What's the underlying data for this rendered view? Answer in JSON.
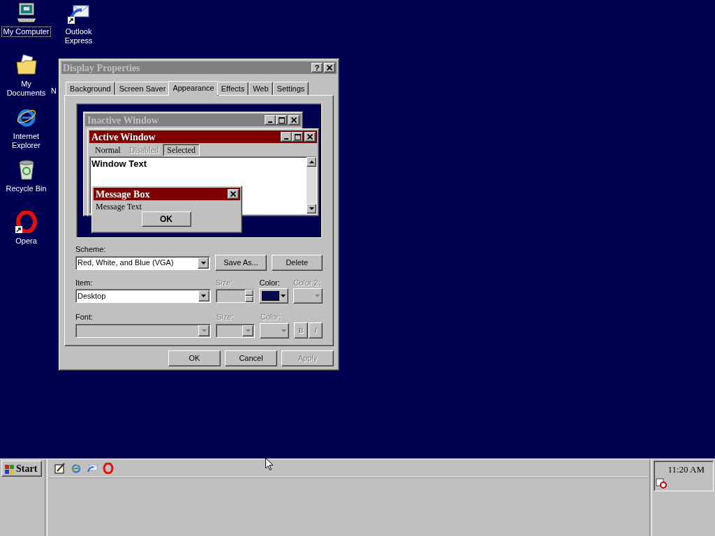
{
  "desktop": {
    "columns": [
      {
        "icons": [
          {
            "kind": "computer",
            "label": "My Computer",
            "shortcut": false,
            "selected": true
          },
          {
            "kind": "documents",
            "label": "My Documents",
            "shortcut": false,
            "selected": false
          },
          {
            "kind": "ie",
            "label": "Internet Explorer",
            "shortcut": false,
            "selected": false
          },
          {
            "kind": "recycle",
            "label": "Recycle Bin",
            "shortcut": false,
            "selected": false
          },
          {
            "kind": "opera",
            "label": "Opera",
            "shortcut": true,
            "selected": false
          }
        ]
      },
      {
        "icons": [
          {
            "kind": "outlook",
            "label": "Outlook Express",
            "shortcut": true,
            "selected": false
          }
        ]
      }
    ],
    "partial_label": "N"
  },
  "dialog": {
    "title": "Display Properties",
    "active": false,
    "help_button": "?",
    "tabs": [
      {
        "label": "Background",
        "selected": false
      },
      {
        "label": "Screen Saver",
        "selected": false
      },
      {
        "label": "Appearance",
        "selected": true
      },
      {
        "label": "Effects",
        "selected": false
      },
      {
        "label": "Web",
        "selected": false
      },
      {
        "label": "Settings",
        "selected": false
      }
    ],
    "preview": {
      "inactive_title": "Inactive Window",
      "active_title": "Active Window",
      "menu": [
        {
          "label": "Normal",
          "disabled": false,
          "selected": false
        },
        {
          "label": "Disabled",
          "disabled": true,
          "selected": false
        },
        {
          "label": "Selected",
          "disabled": false,
          "selected": true
        }
      ],
      "window_text": "Window Text",
      "message_box": {
        "title": "Message Box",
        "text": "Message Text",
        "button": "OK"
      }
    },
    "scheme": {
      "label": "Scheme:",
      "value": "Red, White, and Blue (VGA)",
      "buttons": [
        {
          "label": "Save As...",
          "disabled": false
        },
        {
          "label": "Delete",
          "disabled": false
        }
      ]
    },
    "item": {
      "label": "Item:",
      "value": "Desktop",
      "size": {
        "label": "Size:",
        "disabled": true
      },
      "color": {
        "label": "Color:",
        "disabled": false,
        "color": "#0b0b52"
      },
      "color2": {
        "label": "Color 2:",
        "disabled": true
      }
    },
    "font": {
      "label": "Font:",
      "disabled": true,
      "size": {
        "label": "Size:",
        "disabled": true
      },
      "color": {
        "label": "Color:",
        "disabled": true
      },
      "bold": {
        "label": "B",
        "disabled": true
      },
      "italic": {
        "label": "I",
        "disabled": true
      }
    },
    "buttons": [
      {
        "label": "OK",
        "disabled": false
      },
      {
        "label": "Cancel",
        "disabled": false
      },
      {
        "label": "Apply",
        "disabled": true
      }
    ]
  },
  "taskbar": {
    "start": "Start",
    "quick_launch": [
      {
        "kind": "desktop"
      },
      {
        "kind": "ie"
      },
      {
        "kind": "outlook"
      },
      {
        "kind": "opera"
      }
    ],
    "clock": "11:20 AM",
    "tray": [
      {
        "kind": "scheduler"
      }
    ]
  }
}
